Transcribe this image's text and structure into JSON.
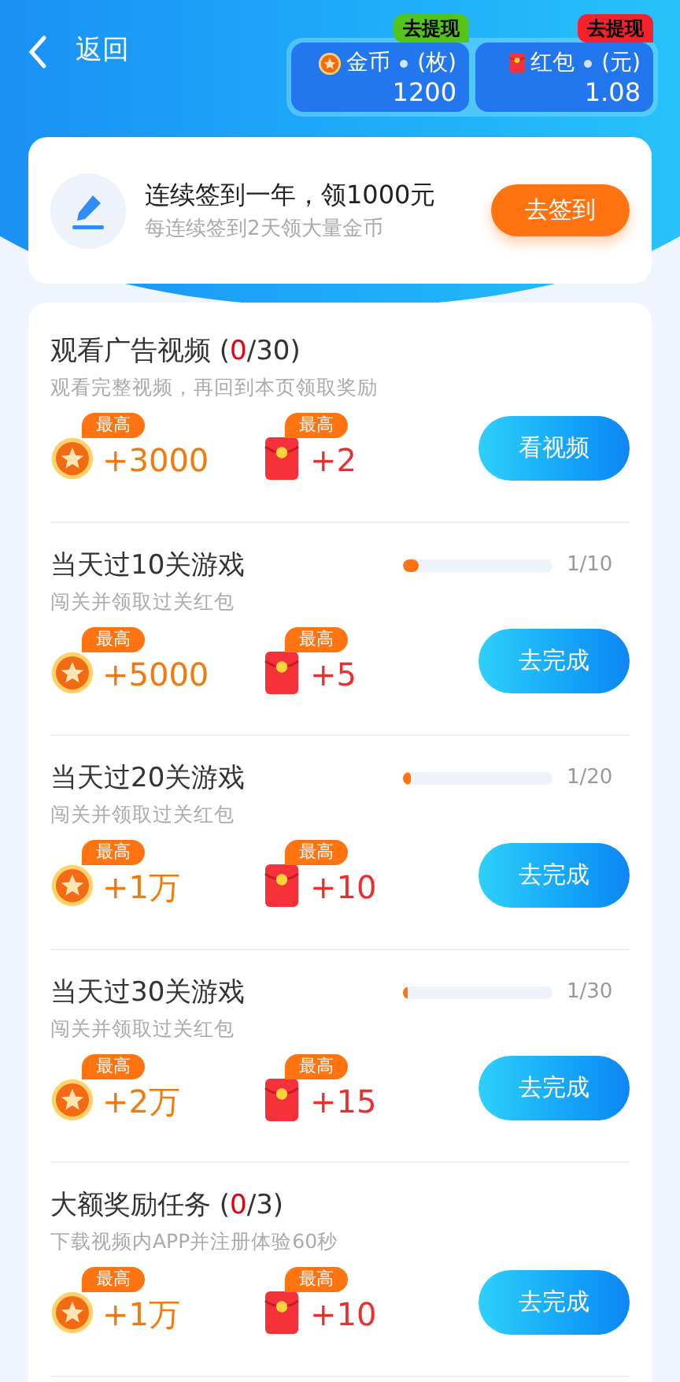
{
  "header": {
    "back_label": "返回"
  },
  "balances": [
    {
      "kind": "coin",
      "label": "金币",
      "unit": "(枚)",
      "value": "1200",
      "tag": "去提现",
      "color": "#52c41a"
    },
    {
      "kind": "redpacket",
      "label": "红包",
      "unit": "(元)",
      "value": "1.08",
      "tag": "去提现",
      "color": "#f5222d"
    }
  ],
  "checkin": {
    "title": "连续签到一年，领1000元",
    "subtitle": "每连续签到2天领大量金币",
    "button": "去签到"
  },
  "tasks": [
    {
      "kind": "count",
      "title": "观看广告视频 (",
      "done": "0",
      "rest": "/30)",
      "subtitle": "观看完整视频，再回到本页领取奖励",
      "coin_badge": "最高",
      "coin": "+3000",
      "packet_badge": "最高",
      "packet": "+2",
      "button": "看视频"
    },
    {
      "kind": "progress",
      "title": "当天过10关游戏",
      "level": 0.1,
      "reading": "1/10",
      "subtitle": "闯关并领取过关红包",
      "coin_badge": "最高",
      "coin": "+5000",
      "packet_badge": "最高",
      "packet": "+5",
      "button": "去完成"
    },
    {
      "kind": "progress",
      "title": "当天过20关游戏",
      "level": 0.05,
      "reading": "1/20",
      "subtitle": "闯关并领取过关红包",
      "coin_badge": "最高",
      "coin": "+1万",
      "packet_badge": "最高",
      "packet": "+10",
      "button": "去完成"
    },
    {
      "kind": "progress",
      "title": "当天过30关游戏",
      "level": 0.033,
      "reading": "1/30",
      "subtitle": "闯关并领取过关红包",
      "coin_badge": "最高",
      "coin": "+2万",
      "packet_badge": "最高",
      "packet": "+15",
      "button": "去完成"
    },
    {
      "kind": "count",
      "title": "大额奖励任务 (",
      "done": "0",
      "rest": "/3)",
      "subtitle": "下载视频内APP并注册体验60秒",
      "coin_badge": "最高",
      "coin": "+1万",
      "packet_badge": "最高",
      "packet": "+10",
      "button": "去完成"
    }
  ]
}
